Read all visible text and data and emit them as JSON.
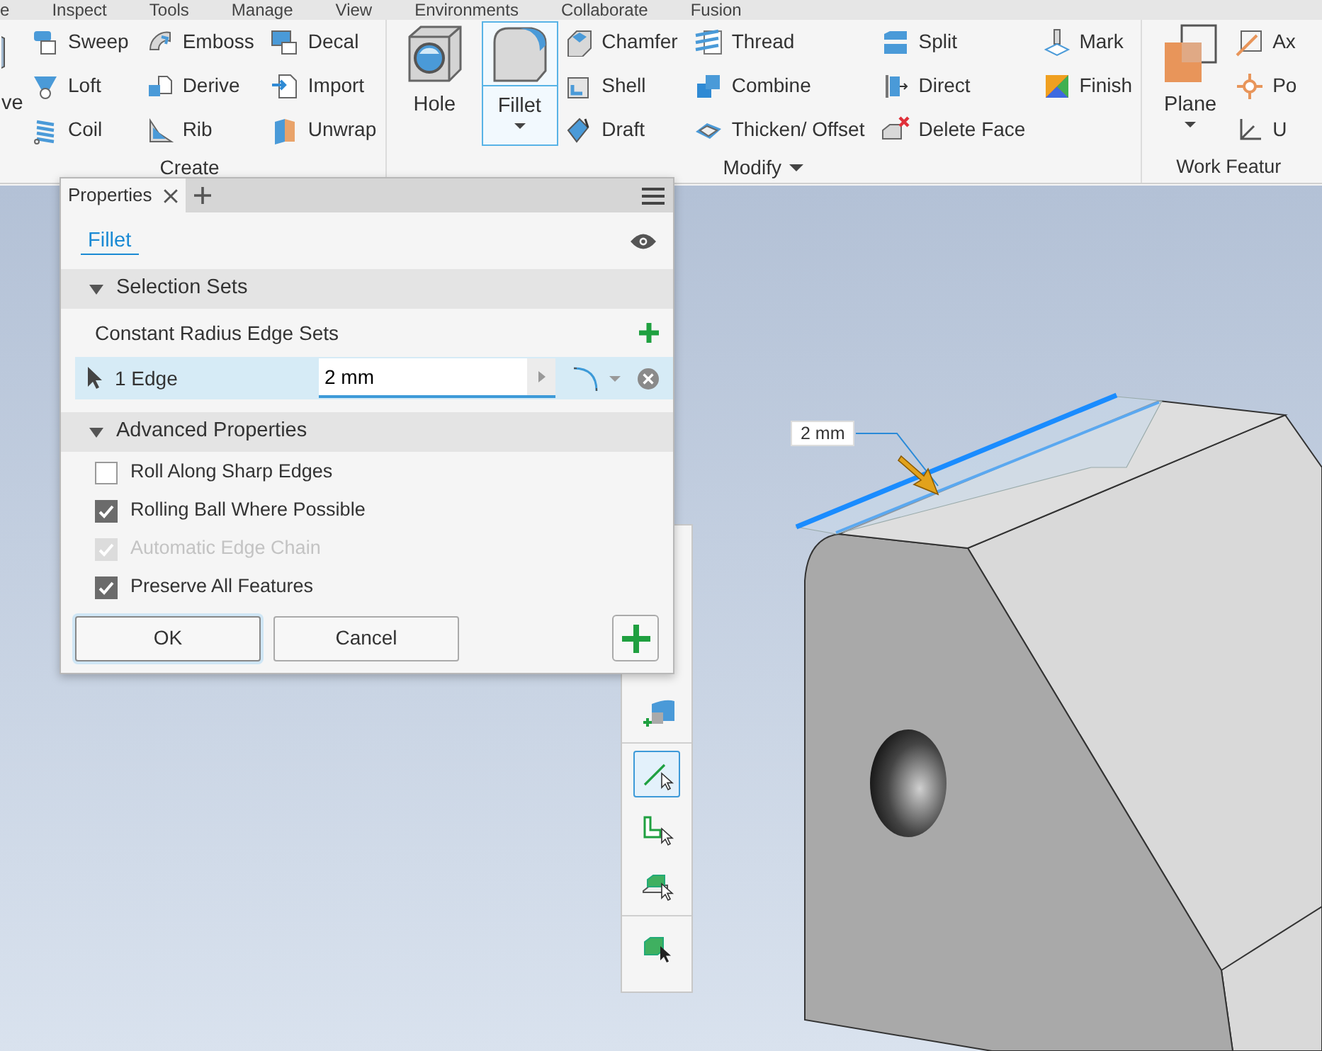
{
  "menu_tabs": [
    "e",
    "Inspect",
    "Tools",
    "Manage",
    "View",
    "Environments",
    "Collaborate",
    "Fusion"
  ],
  "ribbon": {
    "groups": [
      {
        "label": "Create",
        "dropdown": false,
        "items": [
          {
            "label": "ve",
            "kind": "clipped",
            "selected": false,
            "dropdown": false
          },
          {
            "label": "Sweep",
            "kind": "small",
            "selected": false
          },
          {
            "label": "Loft",
            "kind": "small",
            "selected": false
          },
          {
            "label": "Coil",
            "kind": "small",
            "selected": false
          },
          {
            "label": "Emboss",
            "kind": "small",
            "selected": false
          },
          {
            "label": "Derive",
            "kind": "small",
            "selected": false
          },
          {
            "label": "Rib",
            "kind": "small",
            "selected": false
          },
          {
            "label": "Decal",
            "kind": "small",
            "selected": false
          },
          {
            "label": "Import",
            "kind": "small",
            "selected": false
          },
          {
            "label": "Unwrap",
            "kind": "small",
            "selected": false
          }
        ]
      },
      {
        "label": "Modify",
        "dropdown": true,
        "items": [
          {
            "label": "Hole",
            "kind": "large",
            "selected": false,
            "dropdown": false
          },
          {
            "label": "Fillet",
            "kind": "large",
            "selected": true,
            "dropdown": true
          },
          {
            "label": "Chamfer",
            "kind": "small",
            "selected": false
          },
          {
            "label": "Shell",
            "kind": "small",
            "selected": false
          },
          {
            "label": "Draft",
            "kind": "small",
            "selected": false
          },
          {
            "label": "Thread",
            "kind": "small",
            "selected": false
          },
          {
            "label": "Combine",
            "kind": "small",
            "selected": false
          },
          {
            "label": "Thicken/ Offset",
            "kind": "small",
            "selected": false
          },
          {
            "label": "Split",
            "kind": "small",
            "selected": false
          },
          {
            "label": "Direct",
            "kind": "small",
            "selected": false
          },
          {
            "label": "Delete Face",
            "kind": "small",
            "selected": false
          },
          {
            "label": "Mark",
            "kind": "small",
            "selected": false
          },
          {
            "label": "Finish",
            "kind": "small",
            "selected": false
          }
        ]
      },
      {
        "label": "Work Featur",
        "dropdown": false,
        "items": [
          {
            "label": "Plane",
            "kind": "large",
            "selected": false,
            "dropdown": true
          },
          {
            "label": "Ax",
            "kind": "small",
            "selected": false
          },
          {
            "label": "Po",
            "kind": "small",
            "selected": false
          },
          {
            "label": "U",
            "kind": "small",
            "selected": false
          }
        ]
      }
    ]
  },
  "panel": {
    "tab": "Properties",
    "feature": "Fillet",
    "selection_sets": {
      "title": "Selection Sets",
      "expanded": true,
      "set_title": "Constant Radius Edge Sets",
      "rows": [
        {
          "label": "1 Edge",
          "value": "2 mm",
          "selected": true
        }
      ]
    },
    "advanced": {
      "title": "Advanced Properties",
      "expanded": true,
      "options": [
        {
          "label": "Roll Along Sharp Edges",
          "checked": false,
          "disabled": false
        },
        {
          "label": "Rolling Ball Where Possible",
          "checked": true,
          "disabled": false
        },
        {
          "label": "Automatic Edge Chain",
          "checked": true,
          "disabled": true
        },
        {
          "label": "Preserve All Features",
          "checked": true,
          "disabled": false
        }
      ]
    },
    "buttons": [
      {
        "label": "OK",
        "default": true
      },
      {
        "label": "Cancel",
        "default": false
      }
    ]
  },
  "viewport": {
    "dimension_label": "2 mm"
  },
  "select_toolbar": {
    "groups": [
      {
        "tools": [
          {
            "selected": false
          }
        ]
      },
      {
        "tools": [
          {
            "selected": true
          },
          {
            "selected": false
          },
          {
            "selected": false
          }
        ]
      },
      {
        "tools": [
          {
            "selected": false
          }
        ]
      }
    ]
  }
}
